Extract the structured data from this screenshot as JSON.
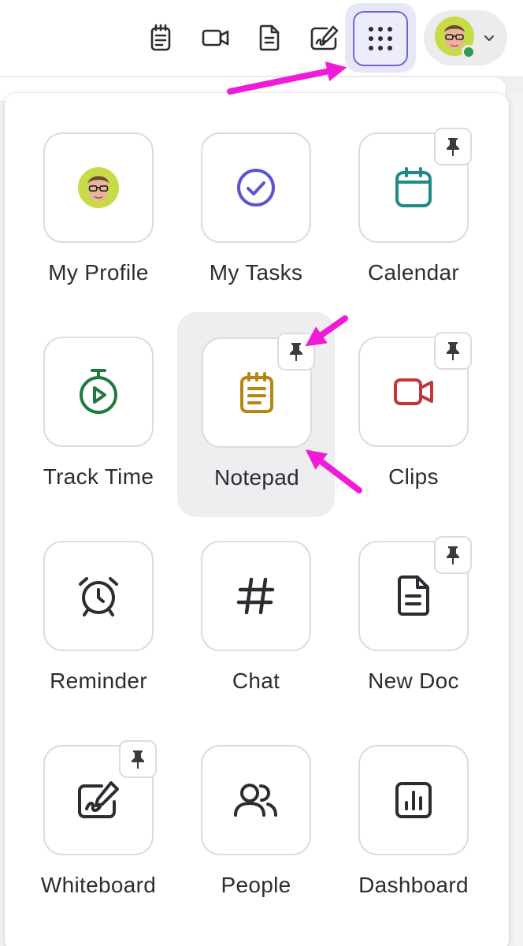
{
  "toolbar": {
    "icons": [
      "notepad-icon",
      "video-icon",
      "doc-icon",
      "whiteboard-icon"
    ],
    "apps_button_icon": "apps-grid-icon",
    "user_status_color": "#2f9a54"
  },
  "apps": [
    {
      "label": "My Profile",
      "icon": "profile-avatar",
      "pinned": false
    },
    {
      "label": "My Tasks",
      "icon": "check-circle-icon",
      "pinned": false,
      "color": "#5a55cf"
    },
    {
      "label": "Calendar",
      "icon": "calendar-icon",
      "pinned": true,
      "color": "#1f8a84"
    },
    {
      "label": "Track Time",
      "icon": "stopwatch-icon",
      "pinned": false,
      "color": "#1f7a3d"
    },
    {
      "label": "Notepad",
      "icon": "notepad-icon",
      "pinned": true,
      "color": "#b78612",
      "highlighted": true
    },
    {
      "label": "Clips",
      "icon": "video-icon",
      "pinned": true,
      "color": "#c0363a"
    },
    {
      "label": "Reminder",
      "icon": "alarm-clock-icon",
      "pinned": false,
      "color": "#2c2c33"
    },
    {
      "label": "Chat",
      "icon": "hashtag-icon",
      "pinned": false,
      "color": "#2c2c33"
    },
    {
      "label": "New Doc",
      "icon": "doc-icon",
      "pinned": true,
      "color": "#2c2c33"
    },
    {
      "label": "Whiteboard",
      "icon": "whiteboard-icon",
      "pinned": true,
      "color": "#2c2c33"
    },
    {
      "label": "People",
      "icon": "people-icon",
      "pinned": false,
      "color": "#2c2c33"
    },
    {
      "label": "Dashboard",
      "icon": "dashboard-icon",
      "pinned": false,
      "color": "#2c2c33"
    }
  ],
  "annotation_color": "#f01bd6"
}
